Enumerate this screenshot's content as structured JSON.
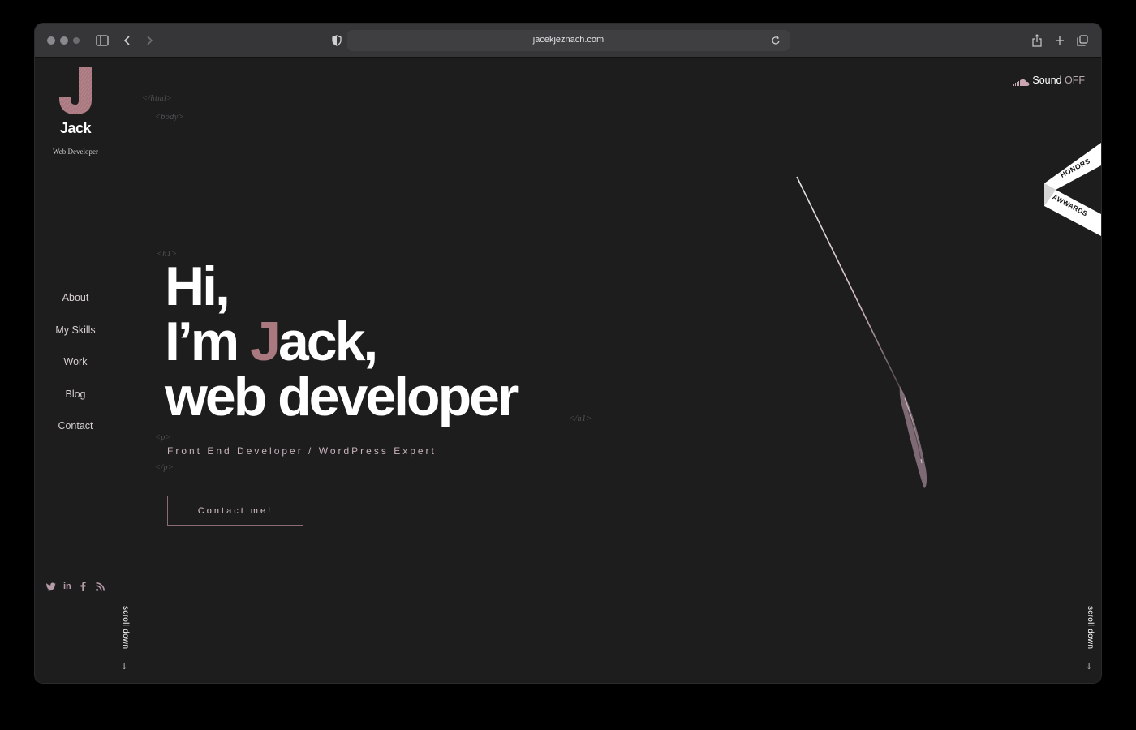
{
  "browser": {
    "url": "jacekjeznach.com",
    "icons": {
      "sidebar": "sidebar-icon",
      "back": "back-icon",
      "forward": "forward-icon",
      "shield": "shield-icon",
      "reload": "reload-icon",
      "share": "share-icon",
      "new_tab": "plus-icon",
      "tabs": "tabs-icon"
    }
  },
  "logo": {
    "letter": "J",
    "name": "Jack",
    "subtitle": "Web Developer"
  },
  "nav": {
    "items": [
      {
        "label": "About"
      },
      {
        "label": "My Skills"
      },
      {
        "label": "Work"
      },
      {
        "label": "Blog"
      },
      {
        "label": "Contact"
      }
    ]
  },
  "social": [
    "twitter-icon",
    "linkedin-icon",
    "facebook-icon",
    "rss-icon"
  ],
  "scroll_label": "scroll down",
  "sound": {
    "label": "Sound",
    "state": "OFF",
    "icon": "soundcloud-icon"
  },
  "code_tags": {
    "html": "</html>",
    "body": "<body>",
    "h1_open": "<h1>",
    "h1_close": "</h1>",
    "p_open": "<p>",
    "p_close": "</p>"
  },
  "hero": {
    "line1": "Hi,",
    "line2_pre": "I’m ",
    "line2_accent": "J",
    "line2_post": "ack,",
    "line3": "web developer",
    "subtitle": "Front End Developer / WordPress Expert",
    "cta_label": "Contact me!"
  },
  "awards": {
    "top": "HONORS",
    "bottom": "AWWARDS"
  },
  "colors": {
    "background": "#1d1d1d",
    "accent": "#a9797f",
    "text": "#ffffff"
  }
}
